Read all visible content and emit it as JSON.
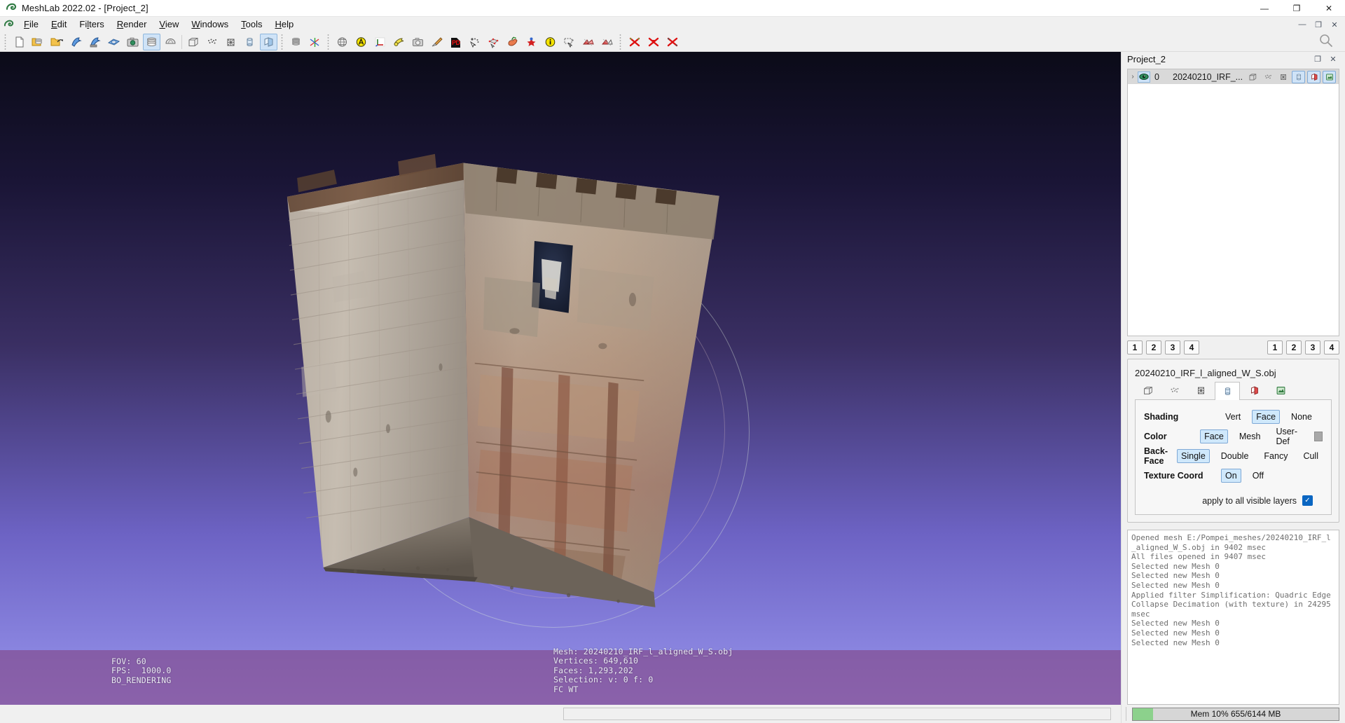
{
  "window": {
    "title": "MeshLab 2022.02 - [Project_2]",
    "app_icon": "meshlab-logo-icon",
    "minimize_label": "—",
    "restore_label": "❐",
    "close_label": "✕"
  },
  "menubar": {
    "mdi_icon": "meshlab-logo-icon",
    "items": [
      {
        "label": "File",
        "accel": "F"
      },
      {
        "label": "Edit",
        "accel": "E"
      },
      {
        "label": "Filters",
        "accel": "l"
      },
      {
        "label": "Render",
        "accel": "R"
      },
      {
        "label": "View",
        "accel": "V"
      },
      {
        "label": "Windows",
        "accel": "W"
      },
      {
        "label": "Tools",
        "accel": "T"
      },
      {
        "label": "Help",
        "accel": "H"
      }
    ],
    "mdi_buttons": [
      {
        "name": "mdi-minimize",
        "glyph": "—"
      },
      {
        "name": "mdi-restore",
        "glyph": "❐"
      },
      {
        "name": "mdi-close",
        "glyph": "✕"
      }
    ]
  },
  "toolbar": {
    "search_icon": "search-icon",
    "groups": [
      {
        "name": "file-group",
        "buttons": [
          {
            "icon": "new-document-icon",
            "state": "off"
          },
          {
            "icon": "open-project-icon",
            "state": "off"
          },
          {
            "icon": "open-mesh-icon",
            "state": "off"
          },
          {
            "icon": "save-mesh-icon",
            "state": "off"
          },
          {
            "icon": "save-mesh-as-icon",
            "state": "off"
          },
          {
            "icon": "save-snapshot-icon",
            "state": "off"
          },
          {
            "icon": "take-snapshot-icon",
            "state": "off"
          },
          {
            "icon": "show-layers-icon",
            "state": "on"
          },
          {
            "icon": "show-raster-icon",
            "state": "off"
          }
        ]
      },
      {
        "name": "render-mode-group",
        "buttons": [
          {
            "icon": "bounding-box-icon",
            "state": "off"
          },
          {
            "icon": "points-icon",
            "state": "off"
          },
          {
            "icon": "wireframe-icon",
            "state": "off"
          },
          {
            "icon": "flat-lines-icon",
            "state": "off"
          },
          {
            "icon": "smooth-shading-icon",
            "state": "on"
          }
        ]
      },
      {
        "name": "stack-group",
        "buttons": [
          {
            "icon": "layer-stack-icon",
            "state": "off"
          },
          {
            "icon": "axes-trackball-icon",
            "state": "off"
          }
        ]
      },
      {
        "name": "edit-tools-group",
        "buttons": [
          {
            "icon": "globe-icon",
            "state": "off"
          },
          {
            "icon": "alpha-sphere-icon",
            "state": "off"
          },
          {
            "icon": "axis-origin-icon",
            "state": "off"
          },
          {
            "icon": "measure-tape-icon",
            "state": "off"
          },
          {
            "icon": "camera-icon",
            "state": "off"
          },
          {
            "icon": "paint-brush-icon",
            "state": "off"
          },
          {
            "icon": "pdf-export-icon",
            "state": "off"
          },
          {
            "icon": "select-vertices-icon",
            "state": "off"
          },
          {
            "icon": "select-connected-icon",
            "state": "off"
          },
          {
            "icon": "pick-points-icon",
            "state": "off"
          },
          {
            "icon": "z-painting-icon",
            "state": "off"
          },
          {
            "icon": "info-icon",
            "state": "off"
          },
          {
            "icon": "rubber-band-icon",
            "state": "off"
          },
          {
            "icon": "select-faces-icon",
            "state": "off"
          },
          {
            "icon": "select-faces-alt-icon",
            "state": "off"
          }
        ]
      },
      {
        "name": "delete-group",
        "buttons": [
          {
            "icon": "delete-selected-faces-icon",
            "state": "off"
          },
          {
            "icon": "delete-selected-vertices-icon",
            "state": "off"
          },
          {
            "icon": "delete-selection-icon",
            "state": "off"
          }
        ]
      }
    ]
  },
  "viewport": {
    "left_info": "FOV: 60\nFPS:  1000.0\nBO_RENDERING",
    "mesh_info": "Mesh: 20240210_IRF_l_aligned_W_S.obj\nVertices: 649,610\nFaces: 1,293,202\nSelection: v: 0 f: 0\nFC WT",
    "background_top_color": "#0b0b18",
    "background_bottom_color": "#9590e8",
    "band_color": "#82407c"
  },
  "dock": {
    "title": "Project_2",
    "undock_glyph": "❐",
    "close_glyph": "✕",
    "layer": {
      "expand_glyph": "›",
      "eye_icon": "visibility-eye-icon",
      "index": "0",
      "name": "20240210_IRF_...",
      "icons": [
        {
          "icon": "bounding-box-icon",
          "state": "off"
        },
        {
          "icon": "points-icon",
          "state": "off"
        },
        {
          "icon": "wireframe-icon",
          "state": "off"
        },
        {
          "icon": "flat-lines-icon",
          "state": "on"
        },
        {
          "icon": "smooth-shading-icon",
          "state": "on"
        },
        {
          "icon": "texture-icon",
          "state": "on"
        }
      ]
    },
    "left_numbers": [
      "1",
      "2",
      "3",
      "4"
    ],
    "right_numbers": [
      "1",
      "2",
      "3",
      "4"
    ],
    "render_group_title": "20240210_IRF_l_aligned_W_S.obj",
    "render_tabs": [
      {
        "icon": "bounding-box-icon",
        "selected": false
      },
      {
        "icon": "points-icon",
        "selected": false
      },
      {
        "icon": "wireframe-icon",
        "selected": false
      },
      {
        "icon": "flat-lines-icon",
        "selected": true
      },
      {
        "icon": "smooth-shading-icon",
        "selected": false
      },
      {
        "icon": "texture-icon",
        "selected": false
      }
    ],
    "properties": [
      {
        "label": "Shading",
        "options": [
          {
            "text": "Vert",
            "sel": false
          },
          {
            "text": "Face",
            "sel": true
          },
          {
            "text": "None",
            "sel": false
          }
        ],
        "swatch": false
      },
      {
        "label": "Color",
        "options": [
          {
            "text": "Face",
            "sel": true
          },
          {
            "text": "Mesh",
            "sel": false
          },
          {
            "text": "User-Def",
            "sel": false
          }
        ],
        "swatch": true,
        "swatch_color": "#a8a8a8"
      },
      {
        "label": "Back-Face",
        "options": [
          {
            "text": "Single",
            "sel": true
          },
          {
            "text": "Double",
            "sel": false
          },
          {
            "text": "Fancy",
            "sel": false
          },
          {
            "text": "Cull",
            "sel": false
          }
        ],
        "swatch": false
      },
      {
        "label": "Texture Coord",
        "options": [
          {
            "text": "On",
            "sel": true
          },
          {
            "text": "Off",
            "sel": false
          }
        ],
        "swatch": false
      }
    ],
    "apply_all_label": "apply to all visible layers",
    "apply_all_checked": true,
    "log": "Opened mesh E:/Pompei_meshes/20240210_IRF_l_aligned_W_S.obj in 9402 msec\nAll files opened in 9407 msec\nSelected new Mesh 0\nSelected new Mesh 0\nSelected new Mesh 0\nApplied filter Simplification: Quadric Edge Collapse Decimation (with texture) in 24295 msec\nSelected new Mesh 0\nSelected new Mesh 0\nSelected new Mesh 0"
  },
  "statusbar": {
    "memory_text": "Mem 10% 655/6144 MB",
    "memory_percent": 10,
    "memory_fill_color": "#8cd18c"
  }
}
